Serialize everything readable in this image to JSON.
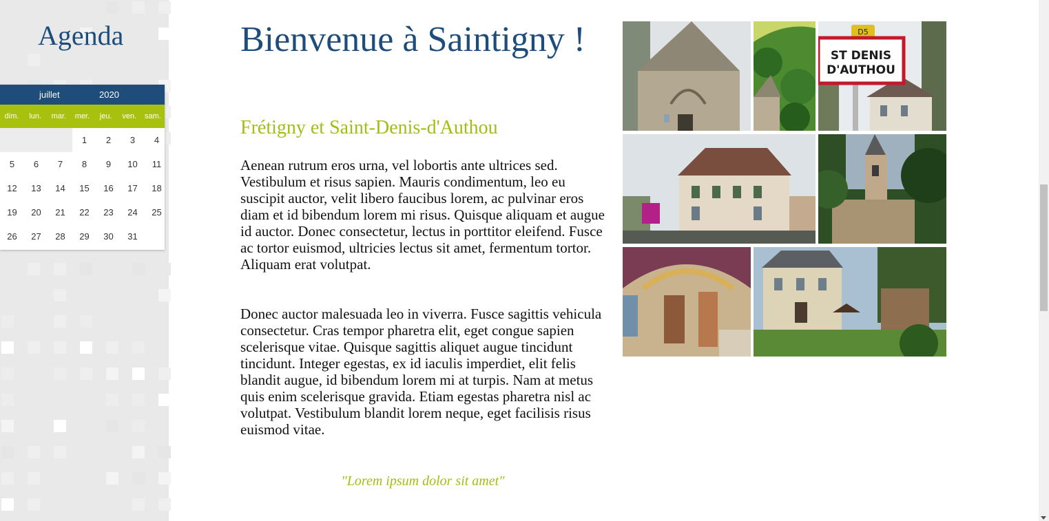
{
  "agenda": {
    "title": "Agenda",
    "month": "juillet",
    "year": "2020",
    "weekdays": [
      "dim.",
      "lun.",
      "mar.",
      "mer.",
      "jeu.",
      "ven.",
      "sam."
    ],
    "weeks": [
      [
        "",
        "",
        "",
        "1",
        "2",
        "3",
        "4"
      ],
      [
        "5",
        "6",
        "7",
        "8",
        "9",
        "10",
        "11"
      ],
      [
        "12",
        "13",
        "14",
        "15",
        "16",
        "17",
        "18"
      ],
      [
        "19",
        "20",
        "21",
        "22",
        "23",
        "24",
        "25"
      ],
      [
        "26",
        "27",
        "28",
        "29",
        "30",
        "31",
        ""
      ]
    ]
  },
  "main": {
    "title": "Bienvenue à Saintigny !",
    "subtitle": "Frétigny et Saint-Denis-d'Authou",
    "paragraph1": "Aenean rutrum eros urna, vel lobortis ante ultrices sed. Vestibulum et risus sapien. Mauris condimentum, leo eu suscipit auctor, velit libero faucibus lorem, ac pulvinar eros diam et id bibendum lorem mi risus. Quisque aliquam et augue id auctor. Donec consectetur, lectus in porttitor eleifend. Fusce ac tortor euismod, ultricies lectus sit amet, fermentum tortor. Aliquam erat volutpat.",
    "paragraph2": "Donec auctor malesuada leo in viverra. Fusce sagittis vehicula consectetur. Cras tempor pharetra elit, eget congue sapien scelerisque vitae. Quisque sagittis aliquet augue tincidunt tincidunt. Integer egestas, ex id iaculis imperdiet, elit felis blandit augue, id bibendum lorem mi at turpis. Nam at metus quis enim scelerisque gravida. Etiam egestas pharetra nisl ac volutpat. Vestibulum blandit lorem neque, eget facilisis risus euismod vitae.",
    "quote": "\"Lorem ipsum dolor sit amet\""
  },
  "gallery": {
    "sign_line1": "ST DENIS",
    "sign_line2": "D'AUTHOU",
    "sign_badge": "D5"
  },
  "colors": {
    "brand_blue": "#1e4d7b",
    "accent_green": "#a2bd14"
  }
}
